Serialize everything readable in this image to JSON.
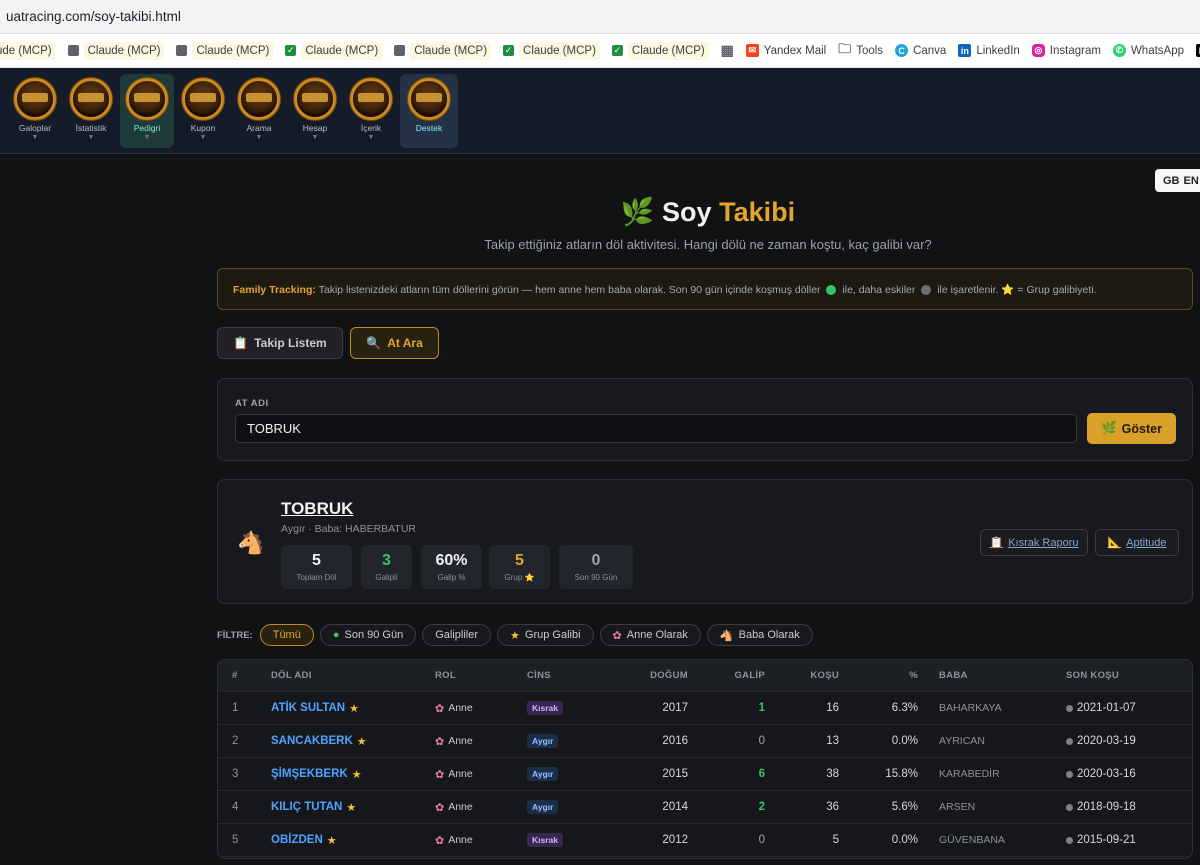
{
  "browser": {
    "url": "uatracing.com/soy-takibi.html",
    "bookmarks": [
      {
        "label": "ude (MCP)",
        "icon": "none"
      },
      {
        "label": "Claude (MCP)",
        "icon": "gray-square-icon"
      },
      {
        "label": "Claude (MCP)",
        "icon": "gray-square-icon"
      },
      {
        "label": "Claude (MCP)",
        "icon": "check-square-icon"
      },
      {
        "label": "Claude (MCP)",
        "icon": "gray-square-icon"
      },
      {
        "label": "Claude (MCP)",
        "icon": "check-square-icon"
      },
      {
        "label": "Claude (MCP)",
        "icon": "check-square-icon"
      },
      {
        "label": "",
        "icon": "apps-grid-icon"
      },
      {
        "label": "Yandex Mail",
        "icon": "mail-icon"
      },
      {
        "label": "Tools",
        "icon": "folder-icon"
      },
      {
        "label": "Canva",
        "icon": "canva-icon"
      },
      {
        "label": "LinkedIn",
        "icon": "linkedin-icon"
      },
      {
        "label": "Instagram",
        "icon": "instagram-icon"
      },
      {
        "label": "WhatsApp",
        "icon": "whatsapp-icon"
      },
      {
        "label": "Medium",
        "icon": "medium-icon"
      }
    ]
  },
  "nav": {
    "items": [
      {
        "label": "Galoplar"
      },
      {
        "label": "İstatistik"
      },
      {
        "label": "Pedigri",
        "active": true
      },
      {
        "label": "Kupon"
      },
      {
        "label": "Arama"
      },
      {
        "label": "Hesap"
      },
      {
        "label": "İçerik"
      },
      {
        "label": "Destek"
      }
    ],
    "lang": "EN",
    "lang_flag": "GB"
  },
  "page": {
    "title_main": "Soy",
    "title_highlight": "Takibi",
    "subtitle": "Takip ettiğiniz atların döl aktivitesi. Hangi dölü ne zaman koştu, kaç galibi var?",
    "info_bold": "Family Tracking:",
    "info_part1": "Takip listenizdeki atların tüm döllerini görün — hem anne hem baba olarak. Son 90 gün içinde koşmuş döller",
    "info_part2": "ile, daha eskiler",
    "info_part3": "ile işaretlenir.",
    "info_part4": "= Grup galibiyeti.",
    "tabs": {
      "watchlist": "Takip Listem",
      "search": "At Ara"
    }
  },
  "search": {
    "label": "AT ADI",
    "value": "TOBRUK",
    "button": "Göster"
  },
  "horse": {
    "name": "TOBRUK",
    "meta": "Aygır · Baba: HABERBATUR",
    "stats": [
      {
        "value": "5",
        "label": "Toplam Döl",
        "color": "#f1f1f1"
      },
      {
        "value": "3",
        "label": "Galipli",
        "color": "#35c46a"
      },
      {
        "value": "60%",
        "label": "Galip %",
        "color": "#f1f1f1"
      },
      {
        "value": "5",
        "label": "Grup ⭐",
        "color": "#e4a52b"
      },
      {
        "value": "0",
        "label": "Son 90 Gün",
        "color": "#9ea3ab"
      }
    ],
    "mare_report": "Kısrak Raporu",
    "aptitude": "Aptitude"
  },
  "filters": {
    "label": "FİLTRE:",
    "chips": [
      "Tümü",
      "Son 90 Gün",
      "Galipliler",
      "Grup Galibi",
      "Anne Olarak",
      "Baba Olarak"
    ]
  },
  "table": {
    "headers": [
      "#",
      "DÖL ADI",
      "ROL",
      "CİNS",
      "DOĞUM",
      "GALİP",
      "KOŞU",
      "%",
      "BABA",
      "SON KOŞU"
    ],
    "rows": [
      {
        "n": "1",
        "name": "ATİK SULTAN",
        "role": "Anne",
        "sex": "Kısrak",
        "birth": "2017",
        "wins": "1",
        "runs": "16",
        "pct": "6.3%",
        "sire": "BAHARKAYA",
        "last": "2021-01-07"
      },
      {
        "n": "2",
        "name": "SANCAKBERK",
        "role": "Anne",
        "sex": "Aygır",
        "birth": "2016",
        "wins": "0",
        "runs": "13",
        "pct": "0.0%",
        "sire": "AYRICAN",
        "last": "2020-03-19"
      },
      {
        "n": "3",
        "name": "ŞİMŞEKBERK",
        "role": "Anne",
        "sex": "Aygır",
        "birth": "2015",
        "wins": "6",
        "runs": "38",
        "pct": "15.8%",
        "sire": "KARABEDİR",
        "last": "2020-03-16"
      },
      {
        "n": "4",
        "name": "KILIÇ TUTAN",
        "role": "Anne",
        "sex": "Aygır",
        "birth": "2014",
        "wins": "2",
        "runs": "36",
        "pct": "5.6%",
        "sire": "ARSEN",
        "last": "2018-09-18"
      },
      {
        "n": "5",
        "name": "OBİZDEN",
        "role": "Anne",
        "sex": "Kısrak",
        "birth": "2012",
        "wins": "0",
        "runs": "5",
        "pct": "0.0%",
        "sire": "GÜVENBANA",
        "last": "2015-09-21"
      }
    ]
  }
}
